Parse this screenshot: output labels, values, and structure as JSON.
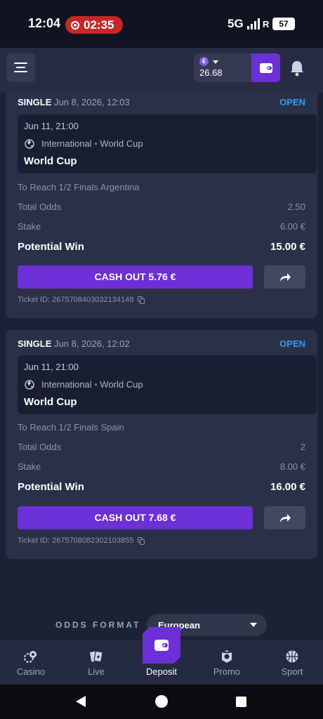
{
  "status_bar": {
    "time": "12:04",
    "recording_time": "02:35",
    "network": "5G",
    "roaming": "R",
    "battery": "57"
  },
  "header": {
    "currency_symbol": "€",
    "balance": "26.68",
    "icons": [
      "menu-icon",
      "wallet-icon",
      "bell-icon"
    ]
  },
  "bets": [
    {
      "type": "SINGLE",
      "placed_at": "Jun 8, 2026, 12:03",
      "status": "OPEN",
      "event_time": "Jun 11, 21:00",
      "region": "International",
      "separator": "•",
      "league": "World Cup",
      "event_name": "World Cup",
      "market": "To Reach 1/2 Finals Argentina",
      "total_odds_label": "Total Odds",
      "total_odds": "2.50",
      "stake_label": "Stake",
      "stake": "6.00 €",
      "potential_win_label": "Potential Win",
      "potential_win": "15.00 €",
      "cashout_label": "CASH OUT 5.76 €",
      "ticket_label": "Ticket ID: 2675708403032134148"
    },
    {
      "type": "SINGLE",
      "placed_at": "Jun 8, 2026, 12:02",
      "status": "OPEN",
      "event_time": "Jun 11, 21:00",
      "region": "International",
      "separator": "•",
      "league": "World Cup",
      "event_name": "World Cup",
      "market": "To Reach 1/2 Finals Spain",
      "total_odds_label": "Total Odds",
      "total_odds": "2",
      "stake_label": "Stake",
      "stake": "8.00 €",
      "potential_win_label": "Potential Win",
      "potential_win": "16.00 €",
      "cashout_label": "CASH OUT 7.68 €",
      "ticket_label": "Ticket ID: 2675708082302103855"
    }
  ],
  "odds_format": {
    "label": "ODDS FORMAT",
    "value": "European"
  },
  "bottom_nav": [
    {
      "label": "Casino",
      "icon": "casino-chips-icon"
    },
    {
      "label": "Live",
      "icon": "cards-icon"
    },
    {
      "label": "Deposit",
      "icon": "wallet-icon"
    },
    {
      "label": "Promo",
      "icon": "promo-icon"
    },
    {
      "label": "Sport",
      "icon": "basketball-icon"
    }
  ],
  "colors": {
    "accent": "#6d2fd6",
    "open_status": "#2c9df0",
    "background": "#1d2136",
    "card": "#2b3049"
  }
}
